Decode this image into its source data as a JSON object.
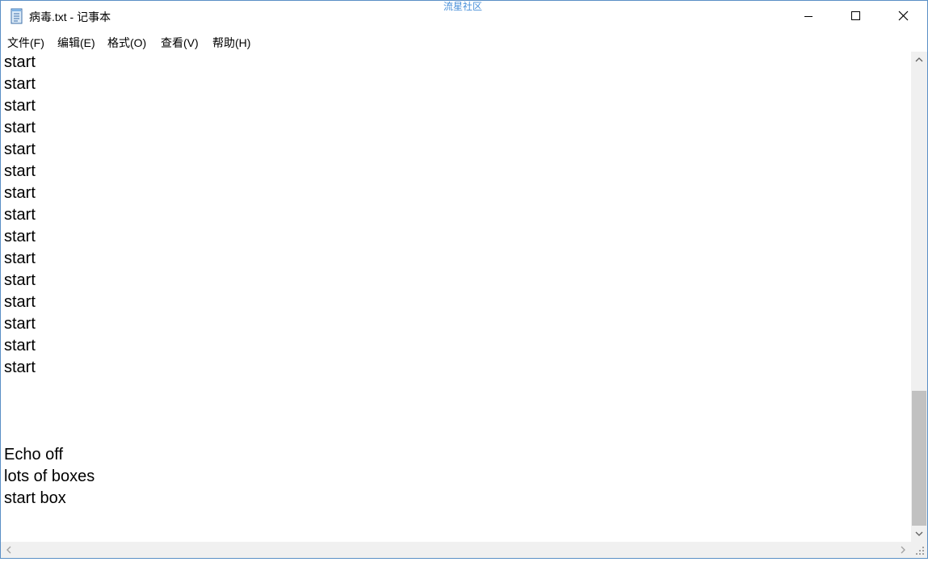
{
  "window": {
    "title": "病毒.txt - 记事本",
    "watermark": "流星社区"
  },
  "menu": {
    "items": [
      {
        "id": "file",
        "label": "文件(F)"
      },
      {
        "id": "edit",
        "label": "编辑(E)"
      },
      {
        "id": "format",
        "label": "格式(O)"
      },
      {
        "id": "view",
        "label": "查看(V)"
      },
      {
        "id": "help",
        "label": "帮助(H)"
      }
    ]
  },
  "editor": {
    "lines": [
      "start",
      "start",
      "start",
      "start",
      "start",
      "start",
      "start",
      "start",
      "start",
      "start",
      "start",
      "start",
      "start",
      "start",
      "start",
      "",
      "",
      "",
      "Echo off",
      "lots of boxes",
      "start box"
    ]
  },
  "icons": {
    "app": "notepad-icon",
    "minimize": "minimize-icon",
    "maximize": "maximize-icon",
    "close": "close-icon",
    "scroll_up": "chevron-up-icon",
    "scroll_down": "chevron-down-icon",
    "scroll_left": "chevron-left-icon",
    "scroll_right": "chevron-right-icon"
  },
  "colors": {
    "window_border": "#5a8fc6",
    "watermark": "#4a90d9",
    "scrollbar_track": "#f0f0f0",
    "scrollbar_thumb": "#c1c1c1"
  }
}
